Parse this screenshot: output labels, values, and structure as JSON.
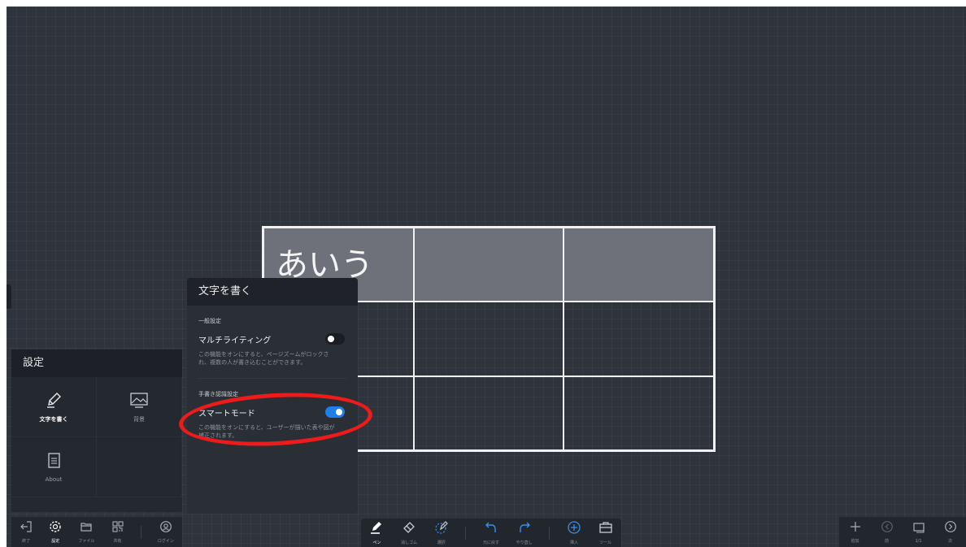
{
  "table": {
    "cells": [
      "あいう",
      "",
      "",
      "",
      "",
      "",
      "",
      "",
      ""
    ]
  },
  "settings": {
    "title": "設定",
    "tiles": [
      {
        "label": "文字を書く",
        "icon": "pen-icon",
        "active": true
      },
      {
        "label": "背景",
        "icon": "image-icon",
        "active": false
      },
      {
        "label": "About",
        "icon": "document-icon",
        "active": false
      }
    ]
  },
  "write_panel": {
    "title": "文字を書く",
    "general_label": "一般設定",
    "multi_title": "マルチライティング",
    "multi_desc": "この機能をオンにすると、ページズームがロックされ、複数の人が書き込むことができます。",
    "multi_enabled": false,
    "section2_label": "手書き認識設定",
    "smart_title": "スマートモード",
    "smart_desc": "この機能をオンにすると、ユーザーが描いた表や図が補正されます。",
    "smart_enabled": true
  },
  "toolbar_left": [
    {
      "label": "終了",
      "icon": "exit-icon"
    },
    {
      "label": "設定",
      "icon": "gear-icon",
      "active": true
    },
    {
      "label": "ファイル",
      "icon": "folder-icon"
    },
    {
      "label": "共有",
      "icon": "qr-code-icon"
    },
    {
      "label": "ログイン",
      "icon": "user-icon"
    }
  ],
  "toolbar_center": [
    {
      "label": "ペン",
      "icon": "pen-icon",
      "active": true
    },
    {
      "label": "消しゴム",
      "icon": "eraser-icon"
    },
    {
      "label": "選択",
      "icon": "lasso-icon"
    },
    {
      "label": "元に戻す",
      "icon": "undo-icon"
    },
    {
      "label": "やり直し",
      "icon": "redo-icon"
    },
    {
      "label": "挿入",
      "icon": "plus-circle-icon"
    },
    {
      "label": "ツール",
      "icon": "toolbox-icon"
    }
  ],
  "toolbar_right": [
    {
      "label": "追加",
      "icon": "plus-icon"
    },
    {
      "label": "前",
      "icon": "prev-icon"
    },
    {
      "label": "1/1",
      "icon": "pages-icon"
    },
    {
      "label": "次",
      "icon": "next-icon"
    }
  ],
  "colors": {
    "canvas": "#2f343c",
    "highlight": "#ee1b1b",
    "toggle_on": "#1f7fe6"
  }
}
